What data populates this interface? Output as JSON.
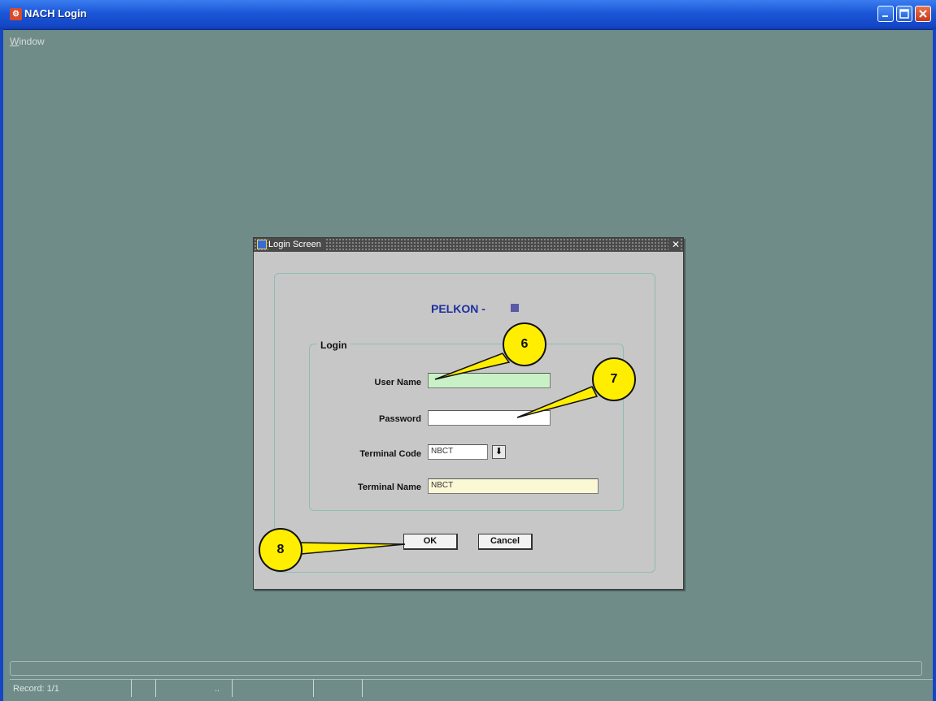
{
  "window": {
    "title": "NACH Login",
    "icon": "app-icon"
  },
  "menu": {
    "window_label": "Window",
    "window_mnemonic": "W",
    "window_rest": "indow"
  },
  "dialog": {
    "title": "Login Screen",
    "close_glyph": "✕",
    "brand": "PELKON -",
    "group_label": "Login",
    "fields": {
      "user_name": {
        "label": "User Name",
        "value": ""
      },
      "password": {
        "label": "Password",
        "value": ""
      },
      "terminal_code": {
        "label": "Terminal Code",
        "value": "NBCT"
      },
      "terminal_name": {
        "label": "Terminal Name",
        "value": "NBCT"
      }
    },
    "buttons": {
      "ok": "OK",
      "cancel": "Cancel"
    },
    "lov_glyph": "⬇"
  },
  "callouts": [
    "6",
    "7",
    "8"
  ],
  "status": {
    "record": "Record: 1/1",
    "dots": ".."
  },
  "colors": {
    "user_field": "#c8f2c6",
    "terminal_name_field": "#fbf8d6",
    "callout": "#ffee00",
    "titlebar": "#1b56d6"
  }
}
